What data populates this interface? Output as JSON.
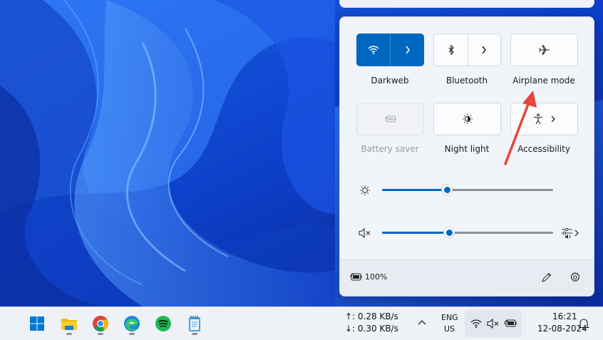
{
  "quick_settings": {
    "tiles": [
      {
        "id": "wifi",
        "label": "Darkweb",
        "state": "on",
        "icon": "wifi-icon",
        "has_chevron": true
      },
      {
        "id": "bluetooth",
        "label": "Bluetooth",
        "state": "off",
        "icon": "bluetooth-icon",
        "has_chevron": true
      },
      {
        "id": "airplane",
        "label": "Airplane mode",
        "state": "off",
        "icon": "airplane-icon",
        "has_chevron": false
      },
      {
        "id": "battery_saver",
        "label": "Battery saver",
        "state": "disabled",
        "icon": "battery-saver-icon",
        "has_chevron": false
      },
      {
        "id": "night_light",
        "label": "Night light",
        "state": "off",
        "icon": "night-light-icon",
        "has_chevron": false
      },
      {
        "id": "accessibility",
        "label": "Accessibility",
        "state": "off",
        "icon": "accessibility-icon",
        "has_chevron": true
      }
    ],
    "brightness_level": 0.38,
    "volume_level": 0.39,
    "volume_muted": true,
    "battery_text": "100%",
    "accent_color": "#0067c0",
    "annotation_color": "#e8453c"
  },
  "taskbar": {
    "apps": [
      "windows-start-icon",
      "file-explorer-icon",
      "chrome-icon",
      "edge-icon",
      "spotify-icon",
      "notepad-icon"
    ],
    "net_speed_up": "↑: 0.28 KB/s",
    "net_speed_down": "↓: 0.30 KB/s",
    "lang_line1": "ENG",
    "lang_line2": "US",
    "time": "16:21",
    "date": "12-08-2024"
  }
}
